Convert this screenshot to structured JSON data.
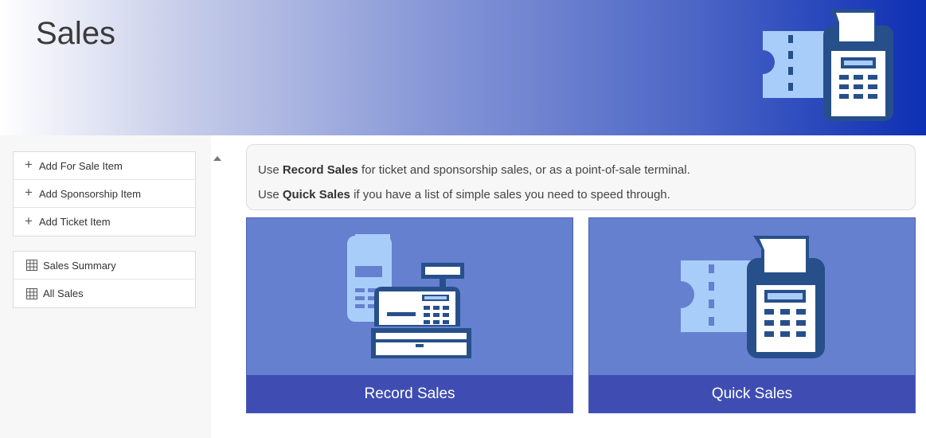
{
  "header": {
    "title": "Sales"
  },
  "sidebar": {
    "add_items": [
      {
        "label": "Add For Sale Item"
      },
      {
        "label": "Add Sponsorship Item"
      },
      {
        "label": "Add Ticket Item"
      }
    ],
    "reports": [
      {
        "label": "Sales Summary"
      },
      {
        "label": "All Sales"
      }
    ]
  },
  "info": {
    "line1": {
      "prefix": "Use ",
      "bold": "Record Sales",
      "suffix": " for ticket and sponsorship sales, or as a point-of-sale terminal."
    },
    "line2": {
      "prefix": "Use ",
      "bold": "Quick Sales",
      "suffix": " if you have a list of simple sales you need to speed through."
    }
  },
  "tiles": [
    {
      "label": "Record Sales",
      "icon": "cash-register-icon"
    },
    {
      "label": "Quick Sales",
      "icon": "ticket-terminal-icon"
    }
  ],
  "colors": {
    "tile_bg": "#6580cf",
    "tile_footer": "#3f4db3",
    "icon_light": "#a9cdf9",
    "icon_dark": "#27508a"
  }
}
